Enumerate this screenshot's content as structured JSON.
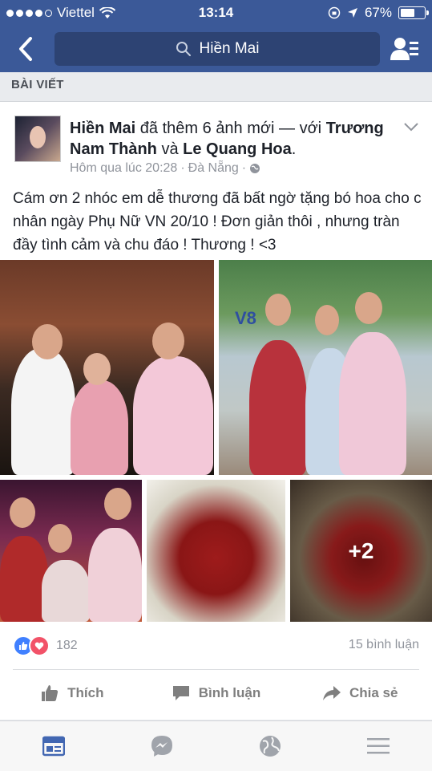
{
  "status_bar": {
    "carrier": "Viettel",
    "time": "13:14",
    "battery": "67%",
    "battery_level": 0.67
  },
  "nav": {
    "search_text": "Hiền Mai"
  },
  "section": {
    "title": "BÀI VIẾT"
  },
  "post": {
    "author": "Hiền Mai",
    "action": " đã thêm 6 ảnh mới — với ",
    "tagged_1": "Trương Nam Thành",
    "conjunction": " và ",
    "tagged_2": "Le Quang Hoa",
    "period": ".",
    "timestamp": "Hôm qua lúc 20:28",
    "location": "Đà Nẵng",
    "separator": "·",
    "text": "Cám ơn 2 nhóc em dễ thương đã bất ngờ tặng bó hoa cho c nhân ngày Phụ Nữ VN 20/10 ! Đơn giản thôi , nhưng tràn đầy tình cảm và chu đáo ! Thương !      <3",
    "more_photos": "+2",
    "sign_text": "V8",
    "reaction_count": "182",
    "comment_count": "15 bình luận"
  },
  "actions": {
    "like": "Thích",
    "comment": "Bình luận",
    "share": "Chia sẻ"
  },
  "icons": {
    "back": "chevron-left-icon",
    "search": "search-icon",
    "friends": "friend-requests-icon",
    "globe": "globe-icon",
    "like": "thumbs-up-icon",
    "love": "heart-icon",
    "tabs": [
      "news-feed-icon",
      "messenger-icon",
      "globe-icon",
      "menu-icon"
    ]
  },
  "colors": {
    "brand": "#3b5998",
    "like_blue": "#4080ff",
    "love_red": "#f25268",
    "active_tab": "#4267b2"
  }
}
